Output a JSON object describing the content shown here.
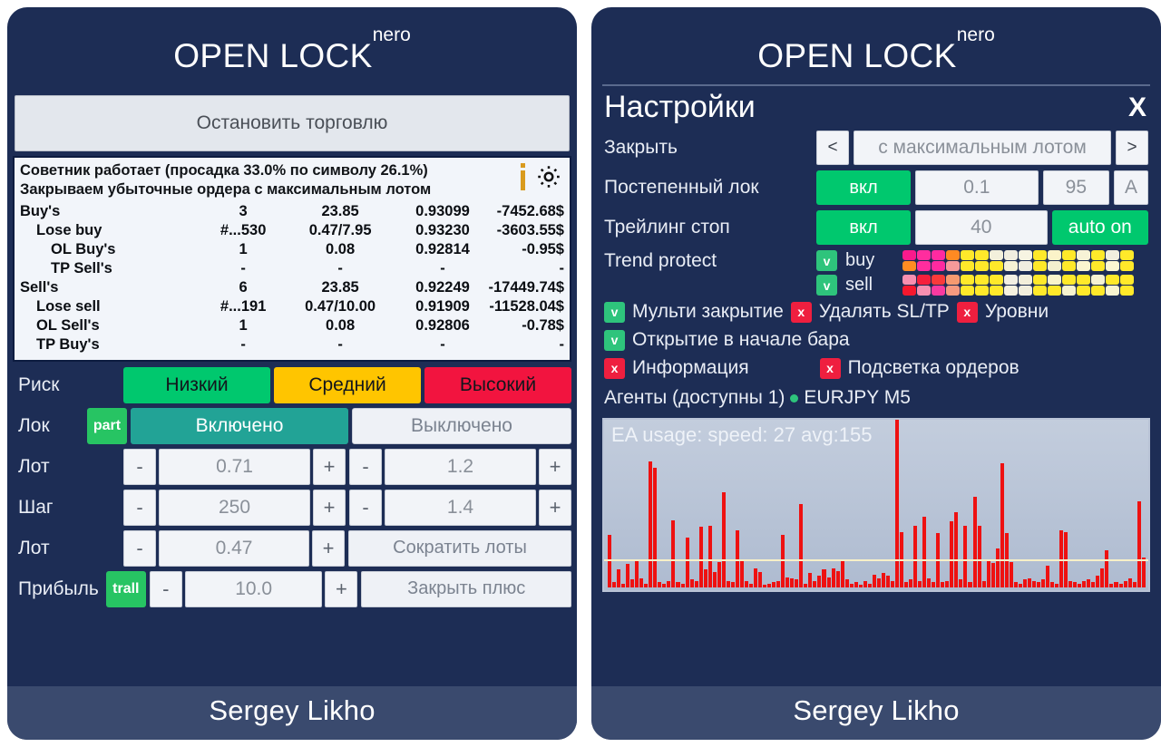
{
  "brand": {
    "name": "OPEN LOCK",
    "sup": "nero"
  },
  "left": {
    "stop_button": "Остановить торговлю",
    "status": {
      "line1": "Советник работает (просадка 33.0% по символу 26.1%)",
      "line2": "Закрываем убыточные ордера с максимальным лотом",
      "info_icon": "info-icon",
      "gear_icon": "gear-icon"
    },
    "orders": [
      {
        "name": "Buy's",
        "indent": 0,
        "count": "3",
        "lot": "23.85",
        "price": "0.93099",
        "pl": "-7452.68$"
      },
      {
        "name": "Lose buy",
        "indent": 1,
        "count": "#...530",
        "lot": "0.47/7.95",
        "price": "0.93230",
        "pl": "-3603.55$"
      },
      {
        "name": "OL Buy's",
        "indent": 2,
        "count": "1",
        "lot": "0.08",
        "price": "0.92814",
        "pl": "-0.95$"
      },
      {
        "name": "TP Sell's",
        "indent": 2,
        "count": "-",
        "lot": "-",
        "price": "-",
        "pl": "-"
      },
      {
        "name": "Sell's",
        "indent": 0,
        "count": "6",
        "lot": "23.85",
        "price": "0.92249",
        "pl": "-17449.74$"
      },
      {
        "name": "Lose sell",
        "indent": 1,
        "count": "#...191",
        "lot": "0.47/10.00",
        "price": "0.91909",
        "pl": "-11528.04$"
      },
      {
        "name": "OL Sell's",
        "indent": 1,
        "count": "1",
        "lot": "0.08",
        "price": "0.92806",
        "pl": "-0.78$"
      },
      {
        "name": "TP Buy's",
        "indent": 1,
        "count": "-",
        "lot": "-",
        "price": "-",
        "pl": "-"
      }
    ],
    "risk": {
      "label": "Риск",
      "low": "Низкий",
      "mid": "Средний",
      "high": "Высокий"
    },
    "lock": {
      "label": "Лок",
      "badge": "part",
      "on": "Включено",
      "off": "Выключено"
    },
    "lot1": {
      "label": "Лот",
      "minus": "-",
      "value": "0.71",
      "plus": "+",
      "minus2": "-",
      "value2": "1.2",
      "plus2": "+"
    },
    "step": {
      "label": "Шаг",
      "minus": "-",
      "value": "250",
      "plus": "+",
      "minus2": "-",
      "value2": "1.4",
      "plus2": "+"
    },
    "lot2": {
      "label": "Лот",
      "minus": "-",
      "value": "0.47",
      "plus": "+",
      "action": "Сократить лоты"
    },
    "profit": {
      "label": "Прибыль",
      "badge": "trall",
      "minus": "-",
      "value": "10.0",
      "plus": "+",
      "action": "Закрыть плюс"
    },
    "footer": "Sergey Likho"
  },
  "right": {
    "settings_title": "Настройки",
    "close": "X",
    "close_row": {
      "label": "Закрыть",
      "prev": "<",
      "value": "с максимальным лотом",
      "next": ">"
    },
    "gradual_lock": {
      "label": "Постепенный лок",
      "toggle": "вкл",
      "value1": "0.1",
      "value2": "95",
      "value3": "A"
    },
    "trailing_stop": {
      "label": "Трейлинг стоп",
      "toggle": "вкл",
      "value": "40",
      "auto": "auto on"
    },
    "trend_protect": {
      "label": "Trend protect",
      "buy": {
        "check": "v",
        "name": "buy"
      },
      "sell": {
        "check": "v",
        "name": "sell"
      },
      "buy_top": [
        "#f91a8c",
        "#ff2d9e",
        "#ff2aa0",
        "#ff8a22",
        "#ffe92a",
        "#ffe92a",
        "#f3f0dc",
        "#f1eee0",
        "#f7f4e2",
        "#ffe92a",
        "#fbf3c9",
        "#ffe92a",
        "#f7f3d6",
        "#ffe92a",
        "#f1eedf",
        "#ffe92a"
      ],
      "buy_bottom": [
        "#ff8c22",
        "#ff2d9e",
        "#ff2aa0",
        "#f79a9a",
        "#ffe92a",
        "#ffe92a",
        "#ffe92a",
        "#f6f2d4",
        "#f0ede1",
        "#ffe92a",
        "#f4f0cf",
        "#ffe92a",
        "#fbf5cf",
        "#ffe92a",
        "#fbf6d2",
        "#ffe92a"
      ],
      "sell_top": [
        "#f78fb0",
        "#f61f3c",
        "#f93a3a",
        "#f79a70",
        "#ffe92a",
        "#ffe92a",
        "#ffe92a",
        "#f2efe3",
        "#f3efdb",
        "#ffe92a",
        "#faf4cc",
        "#ffe92a",
        "#ffe92a",
        "#f6f2d2",
        "#ffe92a",
        "#ffe92a"
      ],
      "sell_bottom": [
        "#f6182e",
        "#f78fb0",
        "#f93aa0",
        "#f79a80",
        "#ffe92a",
        "#ffe92a",
        "#ffe92a",
        "#f5f1e0",
        "#f1eedd",
        "#ffe92a",
        "#ffe92a",
        "#f7f3cf",
        "#ffe92a",
        "#ffe92a",
        "#f9f5d0",
        "#ffe92a"
      ]
    },
    "checkboxes_row1": [
      {
        "state": "v",
        "label": "Мульти закрытие"
      },
      {
        "state": "x",
        "label": "Удалять SL/TP"
      },
      {
        "state": "x",
        "label": "Уровни"
      }
    ],
    "checkboxes_row2": [
      {
        "state": "v",
        "label": "Открытие в начале бара"
      }
    ],
    "checkboxes_row3": [
      {
        "state": "x",
        "label": "Информация"
      },
      {
        "state": "x",
        "label": "Подсветка ордеров"
      }
    ],
    "agents": {
      "text": "Агенты (доступны 1)",
      "symbol": "EURJPY M5"
    },
    "footer": "Sergey Likho"
  },
  "chart_data": {
    "type": "bar",
    "title": "EA usage: speed: 27 avg:155",
    "xlabel": "",
    "ylabel": "",
    "ylim": [
      0,
      260
    ],
    "avg_line": 45,
    "bar_color": "#ee1111",
    "grid": false,
    "legend": "none",
    "values": [
      82,
      8,
      28,
      6,
      36,
      12,
      42,
      14,
      6,
      196,
      186,
      8,
      6,
      10,
      104,
      8,
      6,
      78,
      12,
      10,
      94,
      28,
      96,
      24,
      40,
      148,
      10,
      8,
      88,
      44,
      10,
      6,
      30,
      24,
      4,
      6,
      8,
      10,
      82,
      16,
      14,
      12,
      130,
      6,
      22,
      10,
      18,
      28,
      16,
      30,
      26,
      42,
      12,
      6,
      8,
      4,
      10,
      6,
      20,
      14,
      22,
      18,
      10,
      260,
      86,
      8,
      12,
      96,
      10,
      110,
      14,
      8,
      84,
      8,
      10,
      102,
      116,
      12,
      96,
      8,
      140,
      96,
      10,
      44,
      38,
      60,
      192,
      84,
      40,
      8,
      6,
      12,
      14,
      10,
      8,
      12,
      34,
      8,
      6,
      88,
      86,
      10,
      8,
      6,
      10,
      12,
      8,
      18,
      30,
      58,
      6,
      8,
      6,
      10,
      14,
      8,
      134,
      46
    ]
  }
}
